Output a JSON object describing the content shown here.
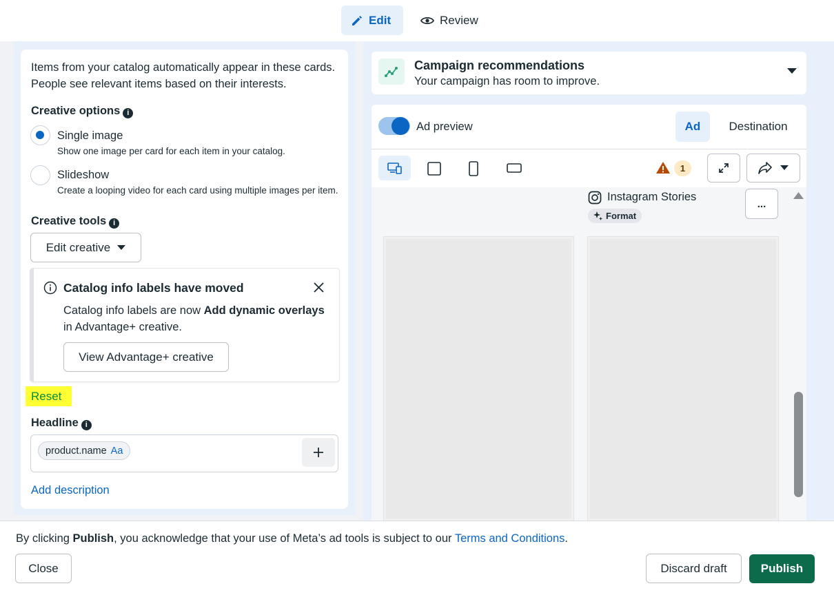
{
  "tabs": {
    "edit": "Edit",
    "review": "Review"
  },
  "left": {
    "catalog_text": "Items from your catalog automatically appear in these cards. People see relevant items based on their interests.",
    "creative_options_label": "Creative options",
    "options": [
      {
        "title": "Single image",
        "desc": "Show one image per card for each item in your catalog.",
        "selected": true
      },
      {
        "title": "Slideshow",
        "desc": "Create a looping video for each card using multiple images per item.",
        "selected": false
      }
    ],
    "creative_tools_label": "Creative tools",
    "edit_creative_label": "Edit creative",
    "callout": {
      "title": "Catalog info labels have moved",
      "body_prefix": "Catalog info labels are now ",
      "body_bold": "Add dynamic overlays",
      "body_suffix": " in Advantage+ creative.",
      "button": "View Advantage+ creative"
    },
    "reset_label": "Reset",
    "headline_label": "Headline",
    "headline_chip": "product.name",
    "headline_chip_suffix": "Aa",
    "add_description_label": "Add description"
  },
  "right": {
    "recommendations_title": "Campaign recommendations",
    "recommendations_sub": "Your campaign has room to improve.",
    "ad_preview_label": "Ad preview",
    "ad_tab": "Ad",
    "destination_tab": "Destination",
    "warning_count": "1",
    "placement_label": "Instagram Stories",
    "format_label": "Format",
    "more_label": "..."
  },
  "footer": {
    "text_prefix": "By clicking ",
    "text_bold": "Publish",
    "text_middle": ", you acknowledge that your use of Meta’s ad tools is subject to our ",
    "terms_link": "Terms and Conditions",
    "text_suffix": ".",
    "close_label": "Close",
    "discard_label": "Discard draft",
    "publish_label": "Publish"
  },
  "colors": {
    "accent": "#0a66c2",
    "publish": "#0b6b4a",
    "highlight": "#ffff33",
    "warning": "#b84a00"
  }
}
